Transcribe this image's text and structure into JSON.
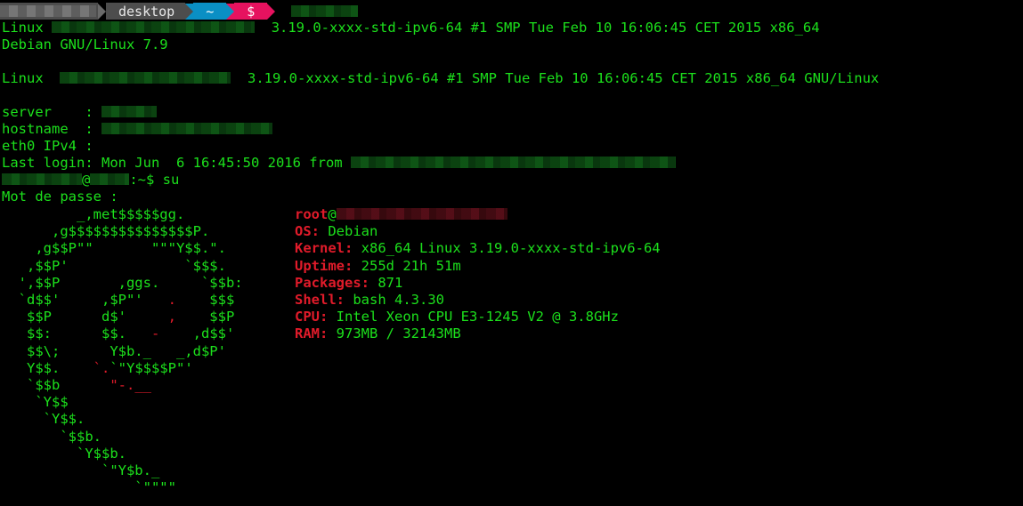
{
  "prompt": {
    "dir": "desktop",
    "home": "~",
    "symbol": "$"
  },
  "lines": {
    "uname_a": "3.19.0-xxxx-std-ipv6-64 #1 SMP Tue Feb 10 16:06:45 CET 2015 x86_64",
    "uname_a_prefix": "Linux",
    "issue": "Debian GNU/Linux 7.9",
    "motd_prefix": "Linux",
    "motd_kernel": "3.19.0-xxxx-std-ipv6-64 #1 SMP Tue Feb 10 16:06:45 CET 2015 x86_64 GNU/Linux",
    "server_label": "server    :",
    "hostname_label": "hostname  :",
    "ipv4_label": "eth0 IPv4 :",
    "last_login": "Last login: Mon Jun  6 16:45:50 2016 from",
    "cmd_at": "@",
    "cmd": ":~$ su",
    "password_prompt": "Mot de passe :"
  },
  "art": {
    "l1": "         _,met$$$$$gg.",
    "l2": "      ,g$$$$$$$$$$$$$$$P.",
    "l3": "    ,g$$P\"\"       \"\"\"Y$$.\".",
    "l4": "   ,$$P'              `$$$.",
    "l5a": "  ',$$P       ,ggs.     `$$b:",
    "l6a": "  `d$$'     ,$P\"'   ",
    "l6b": ".",
    "l6c": "    $$$",
    "l7a": "   $$P      d$'     ",
    "l7b": ",",
    "l7c": "    $$P",
    "l8a": "   $$:      $$.   ",
    "l8b": "-",
    "l8c": "    ,d$$'",
    "l9": "   $$\\;      Y$b._   _,d$P'",
    "l10a": "   Y$$.    ",
    "l10b": "`.",
    "l10c": "`\"Y$$$$P\"'",
    "l11a": "   `$$b      ",
    "l11b": "\"-.__",
    "l12": "    `Y$$",
    "l13": "     `Y$$.",
    "l14": "       `$$b.",
    "l15": "         `Y$$b.",
    "l16": "            `\"Y$b._",
    "l17": "                `\"\"\"\""
  },
  "info": {
    "user": "root",
    "at": "@",
    "os_label": "OS:",
    "os": "Debian",
    "kernel_label": "Kernel:",
    "kernel": "x86_64 Linux 3.19.0-xxxx-std-ipv6-64",
    "uptime_label": "Uptime:",
    "uptime": "255d 21h 51m",
    "packages_label": "Packages:",
    "packages": "871",
    "shell_label": "Shell:",
    "shell": "bash 4.3.30",
    "cpu_label": "CPU:",
    "cpu": "Intel Xeon CPU E3-1245 V2 @ 3.8GHz",
    "ram_label": "RAM:",
    "ram": "973MB / 32143MB"
  },
  "colors": {
    "green": "#1ce01c",
    "red": "#e01b2a",
    "blue": "#0a8fc4",
    "pink": "#e6125f",
    "gray": "#4d4d4d"
  }
}
